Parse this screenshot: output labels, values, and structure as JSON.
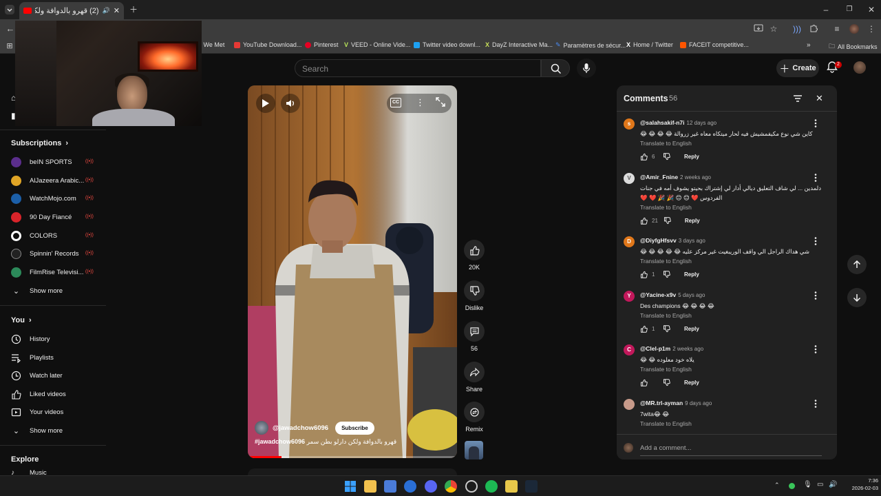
{
  "browser": {
    "tab_title": "(2) قهرو بالدوافة ولكن دارلو",
    "tab_count_badge": "(2)",
    "bookmarks": [
      {
        "label": "e We Met",
        "color": "#555555"
      },
      {
        "label": "YouTube Download...",
        "color": "#e53935"
      },
      {
        "label": "Pinterest",
        "color": "#e60023"
      },
      {
        "label": "VEED - Online Vide...",
        "color": "#b7e35a"
      },
      {
        "label": "Twitter video downl...",
        "color": "#1da1f2"
      },
      {
        "label": "DayZ Interactive Ma...",
        "color": "#c8e05a"
      },
      {
        "label": "Paramètres de sécur...",
        "color": "#4a8cf7"
      },
      {
        "label": "Home / Twitter",
        "color": "#000000"
      },
      {
        "label": "FACEIT competitive...",
        "color": "#ff5500"
      }
    ],
    "all_bookmarks_label": "All Bookmarks"
  },
  "header": {
    "search_placeholder": "Search",
    "create_label": "Create",
    "notifications_count": "2"
  },
  "sidebar": {
    "subscriptions_label": "Subscriptions",
    "channels": [
      {
        "name": "beIN SPORTS",
        "color": "#5b2e8c"
      },
      {
        "name": "AlJazeera Arabic...",
        "color": "#e0a526"
      },
      {
        "name": "WatchMojo.com",
        "color": "#1c5fa8"
      },
      {
        "name": "90 Day Fiancé",
        "color": "#d8242a"
      },
      {
        "name": "COLORS",
        "color": "#ffffff"
      },
      {
        "name": "Spinnin' Records",
        "color": "#222222"
      },
      {
        "name": "FilmRise Televisi...",
        "color": "#2c8a5a"
      }
    ],
    "show_more_1": "Show more",
    "you_label": "You",
    "you_items": [
      "History",
      "Playlists",
      "Watch later",
      "Liked videos",
      "Your videos"
    ],
    "show_more_2": "Show more",
    "explore_label": "Explore",
    "explore_cut_label": "Music"
  },
  "video": {
    "channel_handle": "@jawadchow6096",
    "subscribe_label": "Subscribe",
    "caption_tag": "#jawadchow6096",
    "caption_text": "قهرو بالدوافة ولكن دارلو بطن سمر",
    "progress": 0.16
  },
  "actions": {
    "likes": "20K",
    "dislike_label": "Dislike",
    "comments_count": "56",
    "share_label": "Share",
    "remix_label": "Remix"
  },
  "comments": {
    "title": "Comments",
    "count": "56",
    "translate_label": "Translate to English",
    "reply_label": "Reply",
    "add_placeholder": "Add a comment...",
    "items": [
      {
        "initial": "s",
        "color": "#e0771a",
        "handle": "@salahsakif-n7i",
        "time": "12 days ago",
        "text": "كاين شي نوع مكيفمشيش فيه لحار ميتكاه معاه غير زروالة 😂 😂 😂 😂",
        "rtl": true,
        "likes": "6"
      },
      {
        "initial": "V",
        "color": "#dcdcdc",
        "handle": "@Amir_Fnine",
        "time": "2 weeks ago",
        "text": "دلمدين ... لي شاف التعليق ديالي أدار لي إشتراك بحيتو يشوف أمه في جنات الفردوس ❤️ 😊 😊 🎉 🎉 ❤️ ❤️",
        "rtl": true,
        "likes": "21"
      },
      {
        "initial": "D",
        "color": "#e0771a",
        "handle": "@DiyfgHfsvv",
        "time": "3 days ago",
        "text": "شي هداك الراجل الي واقف الوريبغيت غير مركز عليه 😂 😂 😂 😂 😂",
        "rtl": true,
        "likes": "1"
      },
      {
        "initial": "Y",
        "color": "#c2185b",
        "handle": "@Yacine-x9v",
        "time": "5 days ago",
        "text": "Des champions 😂 😂 😂 😂",
        "rtl": false,
        "likes": "1"
      },
      {
        "initial": "C",
        "color": "#c2185b",
        "handle": "@Clel-p1m",
        "time": "2 weeks ago",
        "text": "يلاه خود معلوده 😂 😂",
        "rtl": true,
        "likes": ""
      },
      {
        "initial": "",
        "color": "#c79a8a",
        "handle": "@MR.trl-ayman",
        "time": "9 days ago",
        "text": "7wita😂 😂",
        "rtl": false,
        "likes": ""
      }
    ]
  },
  "taskbar": {
    "time": "7:36",
    "date": "2026-02-03"
  }
}
